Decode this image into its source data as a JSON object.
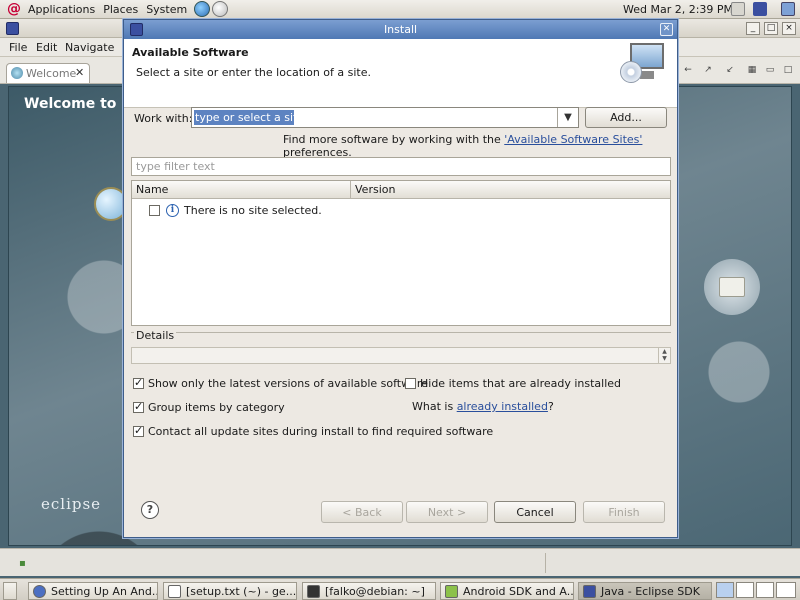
{
  "panel": {
    "menus": [
      "Applications",
      "Places",
      "System"
    ],
    "clock": "Wed Mar  2,  2:39 PM"
  },
  "eclipse": {
    "menus": [
      "File",
      "Edit",
      "Navigate"
    ],
    "tab_label": "Welcome",
    "welcome_title": "Welcome to Ec",
    "logo_text": "eclipse"
  },
  "dialog": {
    "title": "Install",
    "header_title": "Available Software",
    "header_subtitle": "Select a site or enter the location of a site.",
    "work_with_label": "Work with:",
    "site_placeholder": "type or select a site",
    "add_button": "Add...",
    "find_more_prefix": "Find more software by working with the ",
    "find_more_link": "'Available Software Sites'",
    "find_more_suffix": " preferences.",
    "filter_placeholder": "type filter text",
    "columns": [
      "Name",
      "Version"
    ],
    "tree_row_text": "There is no site selected.",
    "details_label": "Details",
    "options": {
      "show_latest": {
        "label": "Show only the latest versions of available software",
        "checked": true
      },
      "hide_installed": {
        "label": "Hide items that are already installed",
        "checked": false
      },
      "group_by_category": {
        "label": "Group items by category",
        "checked": true
      },
      "contact_sites": {
        "label": "Contact all update sites during install to find required software",
        "checked": true
      }
    },
    "what_is_prefix": "What is ",
    "what_is_link": "already installed",
    "what_is_suffix": "?",
    "buttons": {
      "back": "< Back",
      "next": "Next >",
      "cancel": "Cancel",
      "finish": "Finish"
    }
  },
  "taskbar": {
    "tasks": [
      "Setting Up An And...",
      "[setup.txt (~) - ge...",
      "[falko@debian: ~]",
      "Android SDK and A...",
      "Java - Eclipse SDK"
    ]
  },
  "colors": {
    "dialog_title_bg": "#5a80bb",
    "link": "#2a4f9c",
    "selection": "#5d83c1"
  }
}
